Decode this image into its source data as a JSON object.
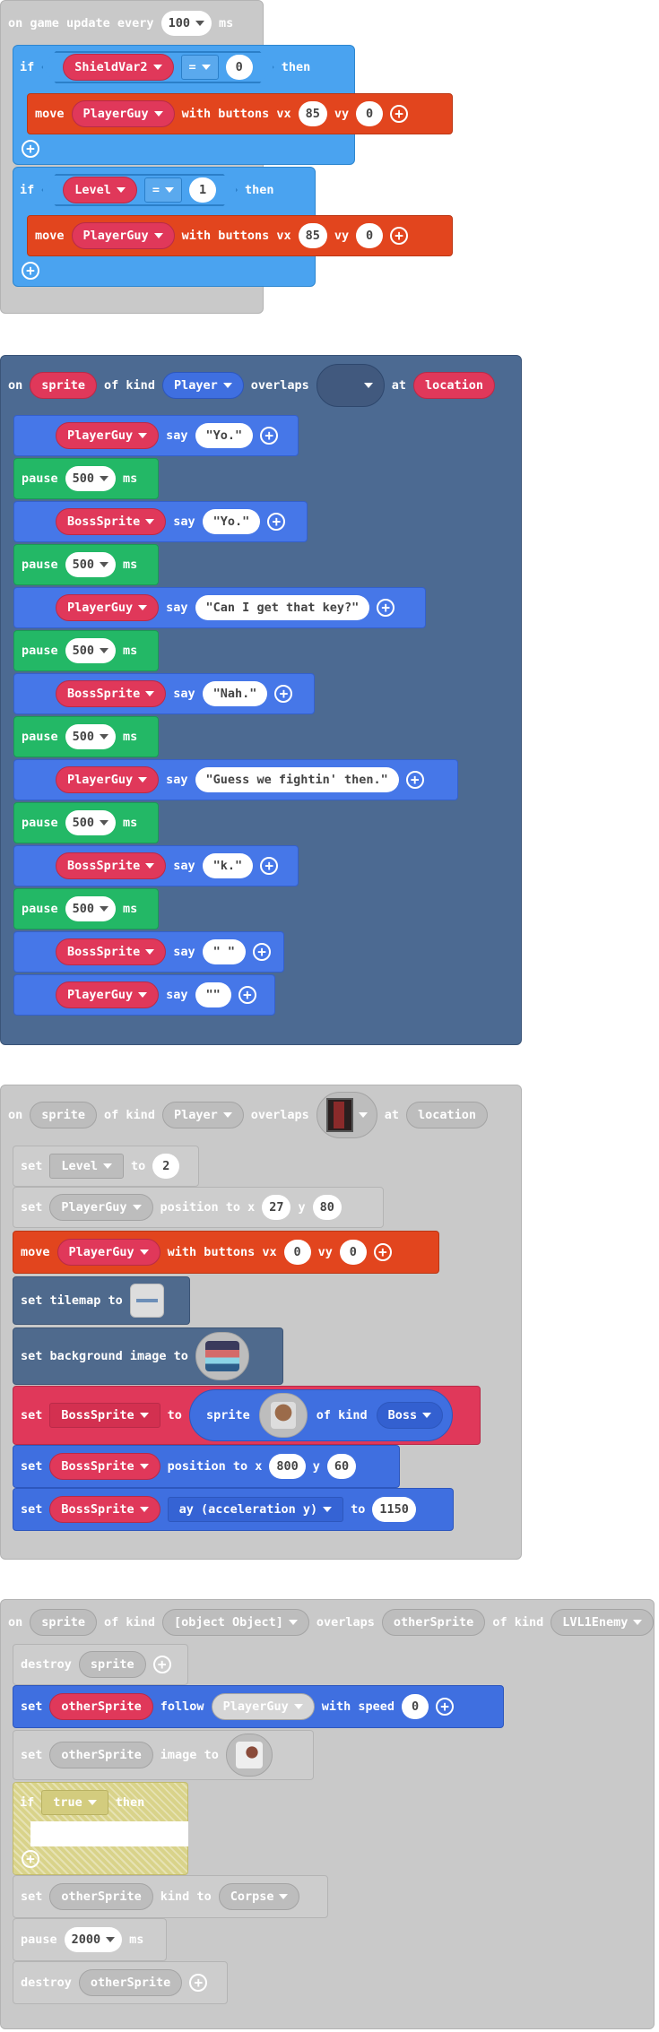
{
  "colors": {
    "event": "#cccccc",
    "eventDark": "#4c6a92",
    "ifBlue": "#4aa3f0",
    "moveOrange": "#e2451e",
    "varRed": "#e0385a",
    "spriteBlue": "#3f6fe0",
    "pauseGreen": "#23b866",
    "disabledGrey": "#c8c8c8",
    "sayBlue": "#4677e8",
    "tilemapNavy": "#4f6a8d"
  },
  "b1": {
    "kw_on": "on game update every",
    "interval": "100",
    "unit": "ms",
    "if1": {
      "kw_if": "if",
      "var": "ShieldVar2",
      "op": "=",
      "value": "0",
      "kw_then": "then"
    },
    "move1": {
      "kw_move": "move",
      "sprite": "PlayerGuy",
      "kw_with": "with buttons vx",
      "vx": "85",
      "kw_vy": "vy",
      "vy": "0"
    },
    "if2": {
      "kw_if": "if",
      "var": "Level",
      "op": "=",
      "value": "1",
      "kw_then": "then"
    },
    "move2": {
      "kw_move": "move",
      "sprite": "PlayerGuy",
      "kw_with": "with buttons vx",
      "vx": "85",
      "kw_vy": "vy",
      "vy": "0"
    }
  },
  "b2": {
    "kw_on": "on",
    "sprite": "sprite",
    "kw_ofkind": "of kind",
    "kind": "Player",
    "kw_overlaps": "overlaps",
    "kw_at": "at",
    "location": "location",
    "kw_say": "say",
    "kw_pause": "pause",
    "kw_ms": "ms",
    "lines": [
      {
        "type": "say",
        "who": "PlayerGuy",
        "text": "\"Yo.\""
      },
      {
        "type": "pause",
        "ms": "500"
      },
      {
        "type": "say",
        "who": "BossSprite",
        "text": "\"Yo.\""
      },
      {
        "type": "pause",
        "ms": "500"
      },
      {
        "type": "say",
        "who": "PlayerGuy",
        "text": "\"Can I get that key?\""
      },
      {
        "type": "pause",
        "ms": "500"
      },
      {
        "type": "say",
        "who": "BossSprite",
        "text": "\"Nah.\""
      },
      {
        "type": "pause",
        "ms": "500"
      },
      {
        "type": "say",
        "who": "PlayerGuy",
        "text": "\"Guess we fightin' then.\""
      },
      {
        "type": "pause",
        "ms": "500"
      },
      {
        "type": "say",
        "who": "BossSprite",
        "text": "\"k.\""
      },
      {
        "type": "pause",
        "ms": "500"
      },
      {
        "type": "say",
        "who": "BossSprite",
        "text": "\" \""
      },
      {
        "type": "say",
        "who": "PlayerGuy",
        "text": "\"\""
      }
    ]
  },
  "b3": {
    "kw_on": "on",
    "sprite": "sprite",
    "kw_ofkind": "of kind",
    "kind": "Player",
    "kw_overlaps": "overlaps",
    "kw_at": "at",
    "location": "location",
    "set_level": {
      "kw_set": "set",
      "var": "Level",
      "kw_to": "to",
      "value": "2"
    },
    "set_pos": {
      "kw_set": "set",
      "sprite": "PlayerGuy",
      "kw_pos": "position to x",
      "x": "27",
      "kw_y": "y",
      "y": "80"
    },
    "move": {
      "kw_move": "move",
      "sprite": "PlayerGuy",
      "kw_with": "with buttons vx",
      "vx": "0",
      "kw_vy": "vy",
      "vy": "0"
    },
    "tilemap": {
      "label": "set tilemap to"
    },
    "bg": {
      "label": "set background image to"
    },
    "set_boss": {
      "kw_set": "set",
      "var": "BossSprite",
      "kw_to": "to",
      "kw_sprite": "sprite",
      "kw_ofkind": "of kind",
      "kind": "Boss"
    },
    "boss_pos": {
      "kw_set": "set",
      "sprite": "BossSprite",
      "kw_pos": "position to x",
      "x": "800",
      "kw_y": "y",
      "y": "60"
    },
    "boss_ay": {
      "kw_set": "set",
      "sprite": "BossSprite",
      "prop": "ay (acceleration y)",
      "kw_to": "to",
      "value": "1150"
    }
  },
  "b4": {
    "kw_on": "on",
    "sprite": "sprite",
    "kw_ofkind": "of kind",
    "kind": {
      "kw_set": "set",
      "sprite": "otherSprite",
      "kw_kind": "kind to",
      "kind": "Corpse"
    },
    "kw_overlaps": "overlaps",
    "other": "otherSprite",
    "kw_ofkind2": "of kind",
    "kind2": "LVL1Enemy",
    "destroy1": {
      "kw": "destroy",
      "target": "sprite"
    },
    "follow": {
      "kw_set": "set",
      "sprite": "otherSprite",
      "kw_follow": "follow",
      "target": "PlayerGuy",
      "kw_speed": "with speed",
      "speed": "0"
    },
    "image": {
      "kw_set": "set",
      "sprite": "otherSprite",
      "kw_img": "image to"
    },
    "if": {
      "kw_if": "if",
      "cond": "true",
      "kw_then": "then"
    },
    "pause": {
      "kw": "pause",
      "ms": "2000",
      "unit": "ms"
    },
    "destroy2": {
      "kw": "destroy",
      "target": "otherSprite"
    }
  }
}
